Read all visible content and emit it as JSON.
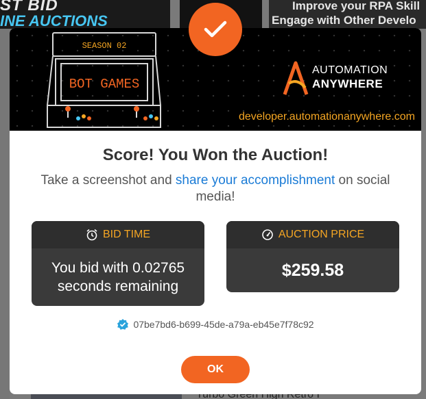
{
  "background": {
    "top_left_line1": "ST BID",
    "top_left_line2": "INE AUCTIONS",
    "top_right_line1": "Improve your RPA Skill",
    "top_right_line2": "Engage with Other Develo",
    "bottom_text": "Turbo Green High Retro I"
  },
  "banner": {
    "season_label": "SEASON 02",
    "screen_label": "BOT GAMES",
    "brand_line1": "AUTOMATION",
    "brand_line2": "ANYWHERE",
    "url": "developer.automationanywhere.com"
  },
  "modal": {
    "title": "Score! You Won the Auction!",
    "subtitle_before": "Take a screenshot and ",
    "subtitle_link": "share your accomplishment",
    "subtitle_after": " on social media!",
    "bid_time": {
      "label": "BID TIME",
      "value": "You bid with 0.02765 seconds remaining"
    },
    "auction_price": {
      "label": "AUCTION PRICE",
      "value": "$259.58"
    },
    "transaction_id": "07be7bd6-b699-45de-a79a-eb45e7f78c92",
    "ok_label": "OK"
  },
  "colors": {
    "accent": "#f26522",
    "label_orange": "#f5a623",
    "link": "#1a7bd6",
    "card_bg": "#3a3a3a"
  },
  "icons": {
    "badge": "checkmark-icon",
    "bid_time": "alarm-clock-icon",
    "auction_price": "speedometer-icon",
    "transaction": "verified-icon"
  }
}
